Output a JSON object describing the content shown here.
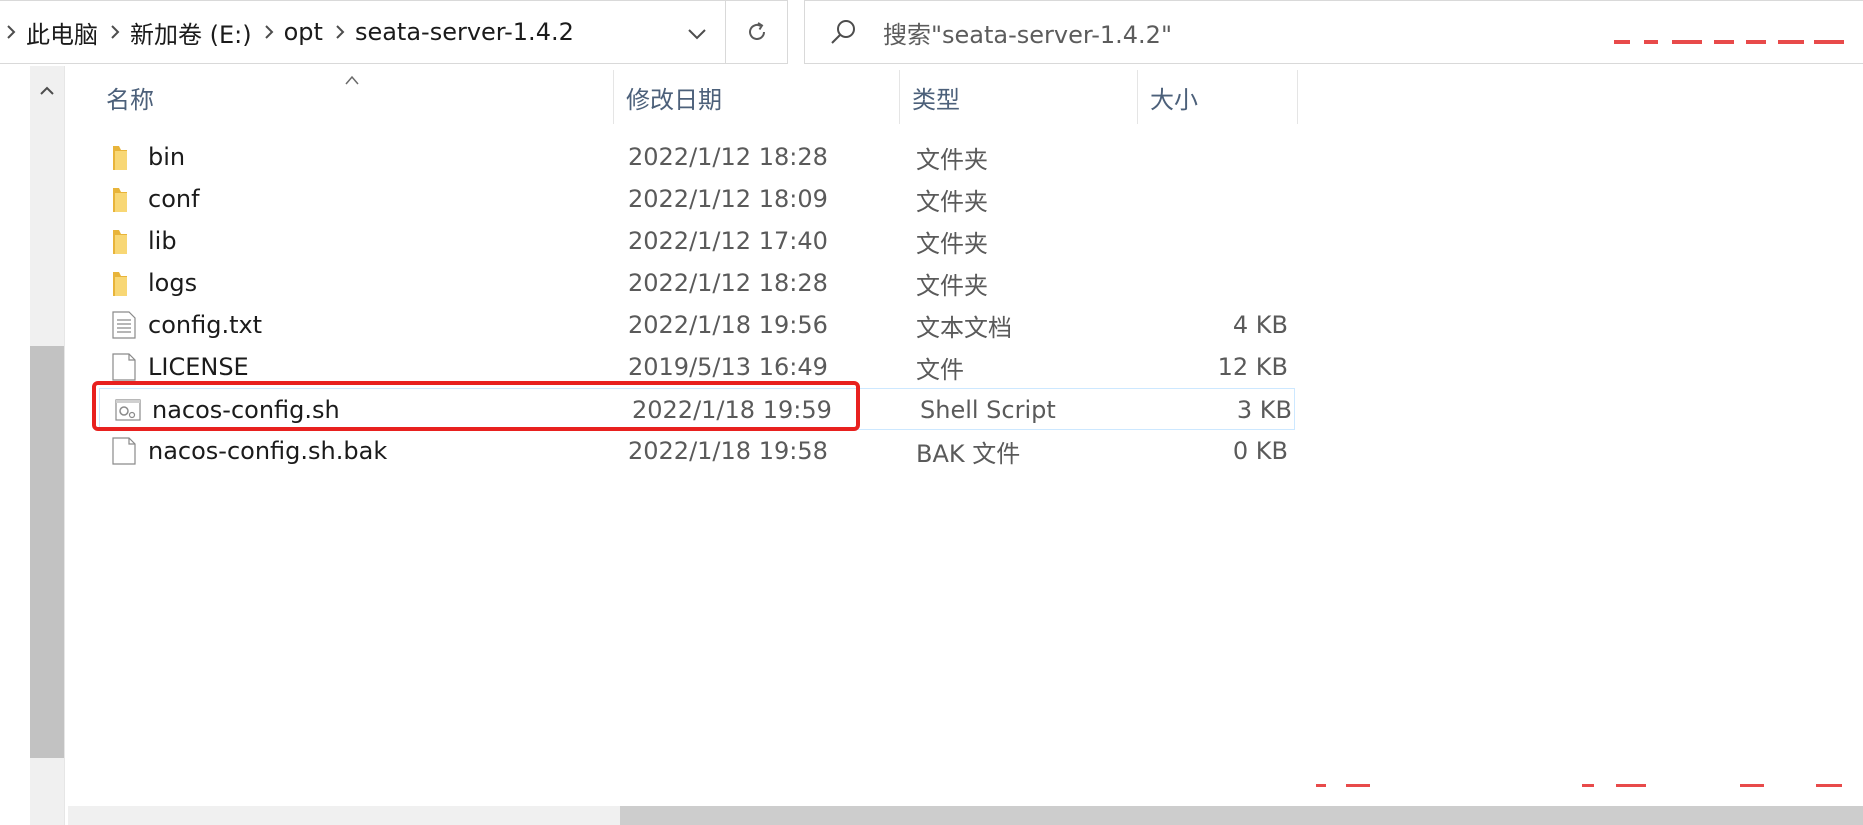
{
  "breadcrumb": {
    "items": [
      "此电脑",
      "新加卷 (E:)",
      "opt",
      "seata-server-1.4.2"
    ]
  },
  "search": {
    "placeholder": "搜索\"seata-server-1.4.2\""
  },
  "columns": {
    "name": "名称",
    "date": "修改日期",
    "type": "类型",
    "size": "大小"
  },
  "files": [
    {
      "name": "bin",
      "date": "2022/1/12 18:28",
      "type": "文件夹",
      "size": "",
      "icon": "folder-icon"
    },
    {
      "name": "conf",
      "date": "2022/1/12 18:09",
      "type": "文件夹",
      "size": "",
      "icon": "folder-icon"
    },
    {
      "name": "lib",
      "date": "2022/1/12 17:40",
      "type": "文件夹",
      "size": "",
      "icon": "folder-icon"
    },
    {
      "name": "logs",
      "date": "2022/1/12 18:28",
      "type": "文件夹",
      "size": "",
      "icon": "folder-icon"
    },
    {
      "name": "config.txt",
      "date": "2022/1/18 19:56",
      "type": "文本文档",
      "size": "4 KB",
      "icon": "text-file-icon"
    },
    {
      "name": "LICENSE",
      "date": "2019/5/13 16:49",
      "type": "文件",
      "size": "12 KB",
      "icon": "blank-file-icon"
    },
    {
      "name": "nacos-config.sh",
      "date": "2022/1/18 19:59",
      "type": "Shell Script",
      "size": "3 KB",
      "icon": "shell-script-icon",
      "selected": true
    },
    {
      "name": "nacos-config.sh.bak",
      "date": "2022/1/18 19:58",
      "type": "BAK 文件",
      "size": "0 KB",
      "icon": "blank-file-icon"
    }
  ],
  "colors": {
    "highlight": "#e8211f",
    "header_text": "#4c607a",
    "selection_border": "#cde8ff",
    "folder": "#f4c542"
  }
}
